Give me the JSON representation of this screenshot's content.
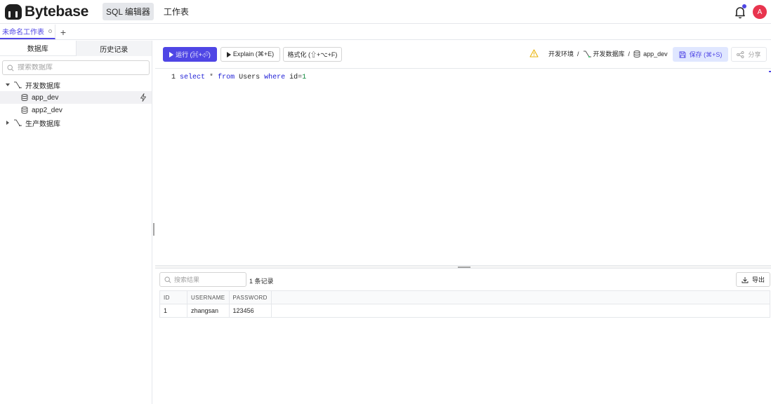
{
  "app": {
    "logo_text": "Bytebase",
    "nav": [
      {
        "label": "SQL 编辑器",
        "active": true
      },
      {
        "label": "工作表",
        "active": false
      }
    ],
    "avatar_initial": "A",
    "bell_icon": "bell-icon",
    "accent_color": "#4f46e5"
  },
  "tabs": {
    "items": [
      {
        "label": "未命名工作表",
        "active": true
      }
    ],
    "add_label": "+"
  },
  "sidebar": {
    "tabs": [
      {
        "label": "数据库",
        "active": true
      },
      {
        "label": "历史记录",
        "active": false
      }
    ],
    "search_placeholder": "搜索数据库",
    "tree": [
      {
        "type": "environment",
        "label": "开发数据库",
        "expanded": true
      },
      {
        "type": "database",
        "label": "app_dev",
        "selected": true
      },
      {
        "type": "database",
        "label": "app2_dev",
        "selected": false
      },
      {
        "type": "environment",
        "label": "生产数据库",
        "expanded": false
      }
    ]
  },
  "toolbar": {
    "run_label": "运行 (⌘+⏎)",
    "explain_label": "Explain (⌘+E)",
    "format_label": "格式化 (⇧+⌥+F)",
    "breadcrumb": {
      "environment": "开发环境",
      "sep": "/",
      "instance": "开发数据库",
      "database": "app_dev"
    },
    "save_label": "保存 (⌘+S)",
    "share_label": "分享"
  },
  "editor": {
    "line_number": "1",
    "tokens": {
      "t1": "select",
      "t2": "*",
      "t3": "from",
      "t4": "Users",
      "t5": "where",
      "t6": "id",
      "t7": "=",
      "t8": "1"
    }
  },
  "results": {
    "search_placeholder": "搜索结果",
    "count_label": "1 条记录",
    "export_label": "导出",
    "columns": [
      "ID",
      "USERNAME",
      "PASSWORD"
    ],
    "rows": [
      [
        "1",
        "zhangsan",
        "123456"
      ]
    ]
  }
}
